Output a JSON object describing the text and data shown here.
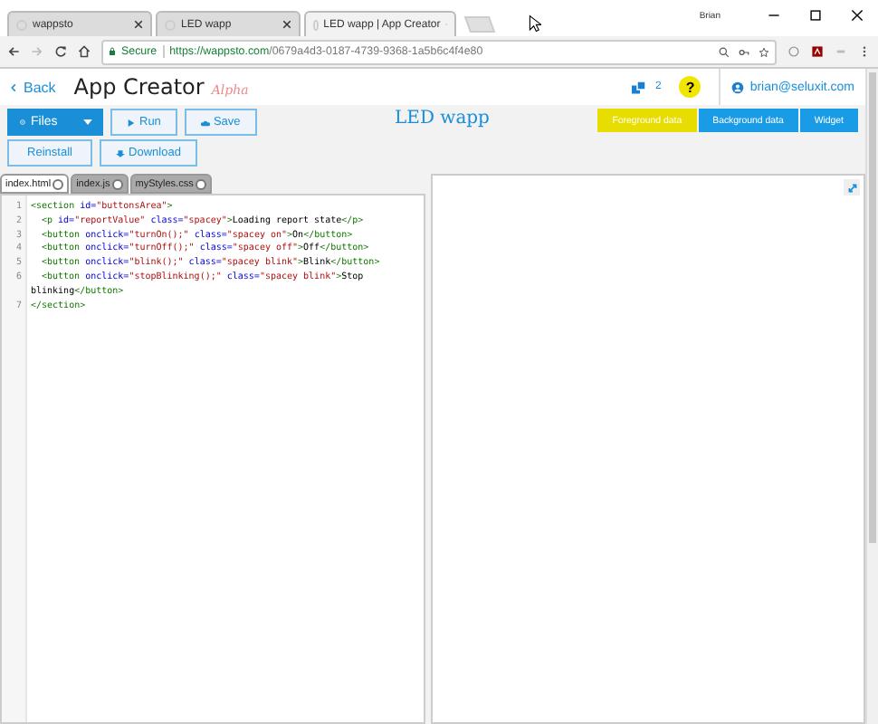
{
  "browser_tabs": [
    {
      "title": "wappsto",
      "selected": false
    },
    {
      "title": "LED wapp",
      "selected": false
    },
    {
      "title": "LED wapp | App Creator",
      "selected": true
    }
  ],
  "window_user": "Brian",
  "address": {
    "secure_label": "Secure",
    "host": "https://wappsto.com",
    "path": "/0679a4d3-0187-4739-9368-1a5b6c4f4e80"
  },
  "header": {
    "back": "Back",
    "title": "App Creator",
    "subtitle": "Alpha",
    "notification_count": "2",
    "help": "?",
    "user": "brian@seluxit.com"
  },
  "toolbar": {
    "files": "Files",
    "run": "Run",
    "save": "Save",
    "reinstall": "Reinstall",
    "download": "Download",
    "app_name": "LED wapp"
  },
  "data_buttons": [
    {
      "label": "Foreground data",
      "selected": true
    },
    {
      "label": "Background data",
      "selected": false
    },
    {
      "label": "Widget",
      "selected": false
    }
  ],
  "file_tabs": [
    {
      "label": "index.html",
      "selected": true
    },
    {
      "label": "index.js",
      "selected": false
    },
    {
      "label": "myStyles.css",
      "selected": false
    }
  ],
  "code_lines": [
    {
      "number": "1",
      "segments": [
        {
          "kind": "tag",
          "text": "<section "
        },
        {
          "kind": "attr",
          "text": "id="
        },
        {
          "kind": "string",
          "text": "\"buttonsArea\""
        },
        {
          "kind": "tag",
          "text": ">"
        }
      ]
    },
    {
      "number": "2",
      "indented": true,
      "segments": [
        {
          "kind": "tag",
          "text": "<p "
        },
        {
          "kind": "attr",
          "text": "id="
        },
        {
          "kind": "string",
          "text": "\"reportValue\""
        },
        {
          "kind": "attr",
          "text": " class="
        },
        {
          "kind": "string",
          "text": "\"spacey\""
        },
        {
          "kind": "tag",
          "text": ">"
        },
        {
          "kind": "text",
          "text": "Loading report state"
        },
        {
          "kind": "tag",
          "text": "</p>"
        }
      ]
    },
    {
      "number": "3",
      "indented": true,
      "segments": [
        {
          "kind": "tag",
          "text": "<button "
        },
        {
          "kind": "attr",
          "text": "onclick="
        },
        {
          "kind": "string",
          "text": "\"turnOn();\""
        },
        {
          "kind": "attr",
          "text": " class="
        },
        {
          "kind": "string",
          "text": "\"spacey on\""
        },
        {
          "kind": "tag",
          "text": ">"
        },
        {
          "kind": "text",
          "text": "On"
        },
        {
          "kind": "tag",
          "text": "</button>"
        }
      ]
    },
    {
      "number": "4",
      "indented": true,
      "segments": [
        {
          "kind": "tag",
          "text": "<button "
        },
        {
          "kind": "attr",
          "text": "onclick="
        },
        {
          "kind": "string",
          "text": "\"turnOff();\""
        },
        {
          "kind": "attr",
          "text": " class="
        },
        {
          "kind": "string",
          "text": "\"spacey off\""
        },
        {
          "kind": "tag",
          "text": ">"
        },
        {
          "kind": "text",
          "text": "Off"
        },
        {
          "kind": "tag",
          "text": "</button>"
        }
      ]
    },
    {
      "number": "5",
      "indented": true,
      "segments": [
        {
          "kind": "tag",
          "text": "<button "
        },
        {
          "kind": "attr",
          "text": "onclick="
        },
        {
          "kind": "string",
          "text": "\"blink();\""
        },
        {
          "kind": "attr",
          "text": " class="
        },
        {
          "kind": "string",
          "text": "\"spacey blink\""
        },
        {
          "kind": "tag",
          "text": ">"
        },
        {
          "kind": "text",
          "text": "Blink"
        },
        {
          "kind": "tag",
          "text": "</button>"
        }
      ]
    },
    {
      "number": "6",
      "indented": true,
      "segments": [
        {
          "kind": "tag",
          "text": "<button "
        },
        {
          "kind": "attr",
          "text": "onclick="
        },
        {
          "kind": "string",
          "text": "\"stopBlinking();\""
        },
        {
          "kind": "attr",
          "text": " class="
        },
        {
          "kind": "string",
          "text": "\"spacey blink\""
        },
        {
          "kind": "tag",
          "text": ">"
        },
        {
          "kind": "text",
          "text": "Stop"
        }
      ]
    },
    {
      "segments": [
        {
          "kind": "text",
          "text": "blinking"
        },
        {
          "kind": "tag",
          "text": "</button>"
        }
      ]
    },
    {
      "number": "7",
      "segments": [
        {
          "kind": "tag",
          "text": "</section>"
        }
      ]
    }
  ]
}
